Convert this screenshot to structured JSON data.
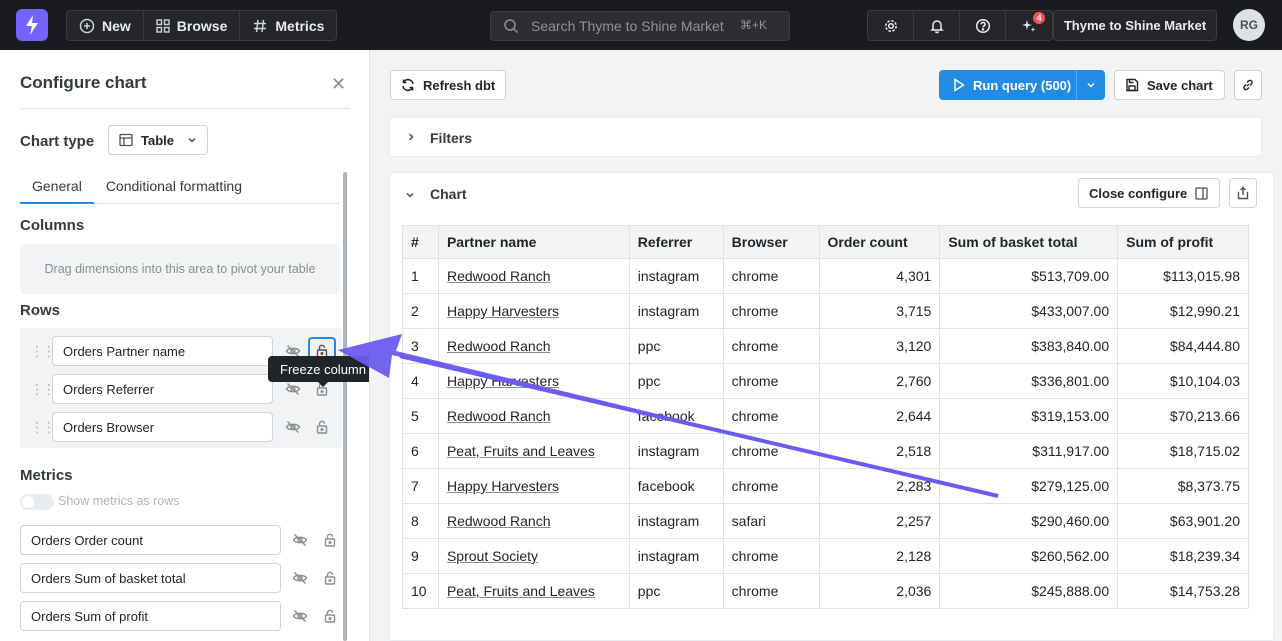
{
  "topbar": {
    "nav": [
      {
        "label": "New",
        "icon": "plus-circle-icon"
      },
      {
        "label": "Browse",
        "icon": "grid-icon"
      },
      {
        "label": "Metrics",
        "icon": "hash-icon"
      }
    ],
    "search_placeholder": "Search Thyme to Shine Market",
    "search_shortcut": "⌘+K",
    "notification_count": "4",
    "org_name": "Thyme to Shine Market",
    "avatar_initials": "RG"
  },
  "config": {
    "title": "Configure chart",
    "chart_type_label": "Chart type",
    "chart_type_value": "Table",
    "tabs": [
      "General",
      "Conditional formatting"
    ],
    "active_tab": "General",
    "columns_label": "Columns",
    "columns_placeholder": "Drag dimensions into this area to pivot your table",
    "rows_label": "Rows",
    "rows": [
      "Orders Partner name",
      "Orders Referrer",
      "Orders Browser"
    ],
    "metrics_label": "Metrics",
    "metrics_toggle_label": "Show metrics as rows",
    "metrics": [
      "Orders Order count",
      "Orders Sum of basket total",
      "Orders Sum of profit"
    ],
    "tooltip": "Freeze column"
  },
  "toolbar": {
    "refresh_label": "Refresh dbt",
    "run_label": "Run query (500)",
    "save_label": "Save chart"
  },
  "filters": {
    "title": "Filters"
  },
  "chart": {
    "title": "Chart",
    "close_configure_label": "Close configure"
  },
  "table": {
    "headers": [
      "#",
      "Partner name",
      "Referrer",
      "Browser",
      "Order count",
      "Sum of basket total",
      "Sum of profit"
    ],
    "rows": [
      [
        "1",
        "Redwood Ranch",
        "instagram",
        "chrome",
        "4,301",
        "$513,709.00",
        "$113,015.98"
      ],
      [
        "2",
        "Happy Harvesters",
        "instagram",
        "chrome",
        "3,715",
        "$433,007.00",
        "$12,990.21"
      ],
      [
        "3",
        "Redwood Ranch",
        "ppc",
        "chrome",
        "3,120",
        "$383,840.00",
        "$84,444.80"
      ],
      [
        "4",
        "Happy Harvesters",
        "ppc",
        "chrome",
        "2,760",
        "$336,801.00",
        "$10,104.03"
      ],
      [
        "5",
        "Redwood Ranch",
        "facebook",
        "chrome",
        "2,644",
        "$319,153.00",
        "$70,213.66"
      ],
      [
        "6",
        "Peat, Fruits and Leaves",
        "instagram",
        "chrome",
        "2,518",
        "$311,917.00",
        "$18,715.02"
      ],
      [
        "7",
        "Happy Harvesters",
        "facebook",
        "chrome",
        "2,283",
        "$279,125.00",
        "$8,373.75"
      ],
      [
        "8",
        "Redwood Ranch",
        "instagram",
        "safari",
        "2,257",
        "$290,460.00",
        "$63,901.20"
      ],
      [
        "9",
        "Sprout Society",
        "instagram",
        "chrome",
        "2,128",
        "$260,562.00",
        "$18,239.34"
      ],
      [
        "10",
        "Peat, Fruits and Leaves",
        "ppc",
        "chrome",
        "2,036",
        "$245,888.00",
        "$14,753.28"
      ]
    ]
  },
  "colors": {
    "accent": "#228be6",
    "brand": "#7262ff",
    "annotation_arrow": "#6a5cf0"
  }
}
